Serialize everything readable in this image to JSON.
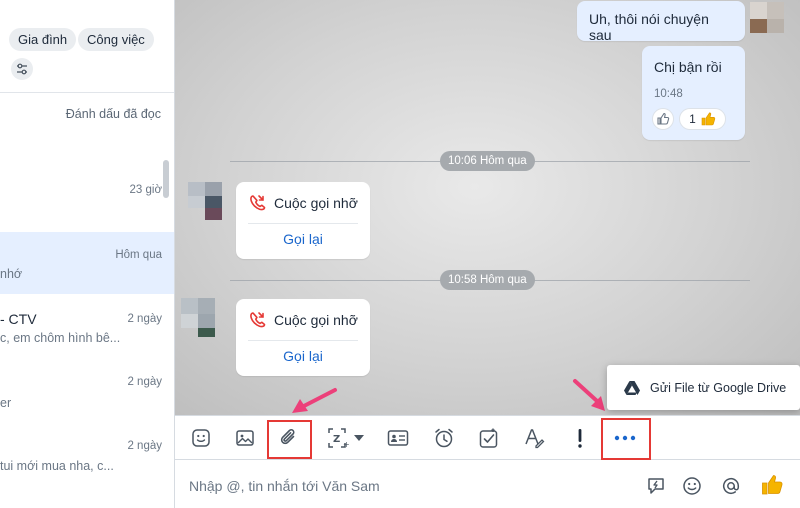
{
  "sidebar": {
    "chips": [
      "Gia đình",
      "Công việc"
    ],
    "mark_read": "Đánh dấu đã đọc",
    "conversations": [
      {
        "time": "23 giờ",
        "name": "",
        "preview": ""
      },
      {
        "time": "Hôm qua",
        "name": "",
        "preview": "nhớ"
      },
      {
        "time": "2 ngày",
        "name": "- CTV",
        "preview": "c, em chôm hình bê..."
      },
      {
        "time": "2 ngày",
        "name": "",
        "preview": "er"
      },
      {
        "time": "2 ngày",
        "name": "",
        "preview": "tui mới mua nha, c..."
      }
    ]
  },
  "chat": {
    "messages_me": [
      {
        "text": "Uh, thôi nói chuyện sau"
      },
      {
        "text": "Chị bận rồi",
        "time": "10:48",
        "reaction_count": "1"
      }
    ],
    "separators": [
      "10:06 Hôm qua",
      "10:58 Hôm qua"
    ],
    "missed_calls": [
      {
        "label": "Cuộc gọi nhỡ",
        "action": "Gọi lại"
      },
      {
        "label": "Cuộc gọi nhỡ",
        "action": "Gọi lại"
      }
    ]
  },
  "drive_popup": {
    "label": "Gửi File từ Google Drive"
  },
  "toolbar": {
    "icons": [
      "sticker-icon",
      "image-icon",
      "attachment-icon",
      "screenshot-icon",
      "business-card-icon",
      "reminder-icon",
      "task-icon",
      "text-format-icon",
      "urgent-icon",
      "more-icon"
    ],
    "highlight_color": "#e53935"
  },
  "composer": {
    "placeholder": "Nhập @, tin nhắn tới Văn Sam",
    "icons": [
      "quick-message-icon",
      "emoji-icon",
      "mention-icon",
      "thumbs-up-icon"
    ]
  },
  "colors": {
    "accent": "#1a66cc",
    "arrow": "#ec407a",
    "missed_call": "#e53935"
  }
}
